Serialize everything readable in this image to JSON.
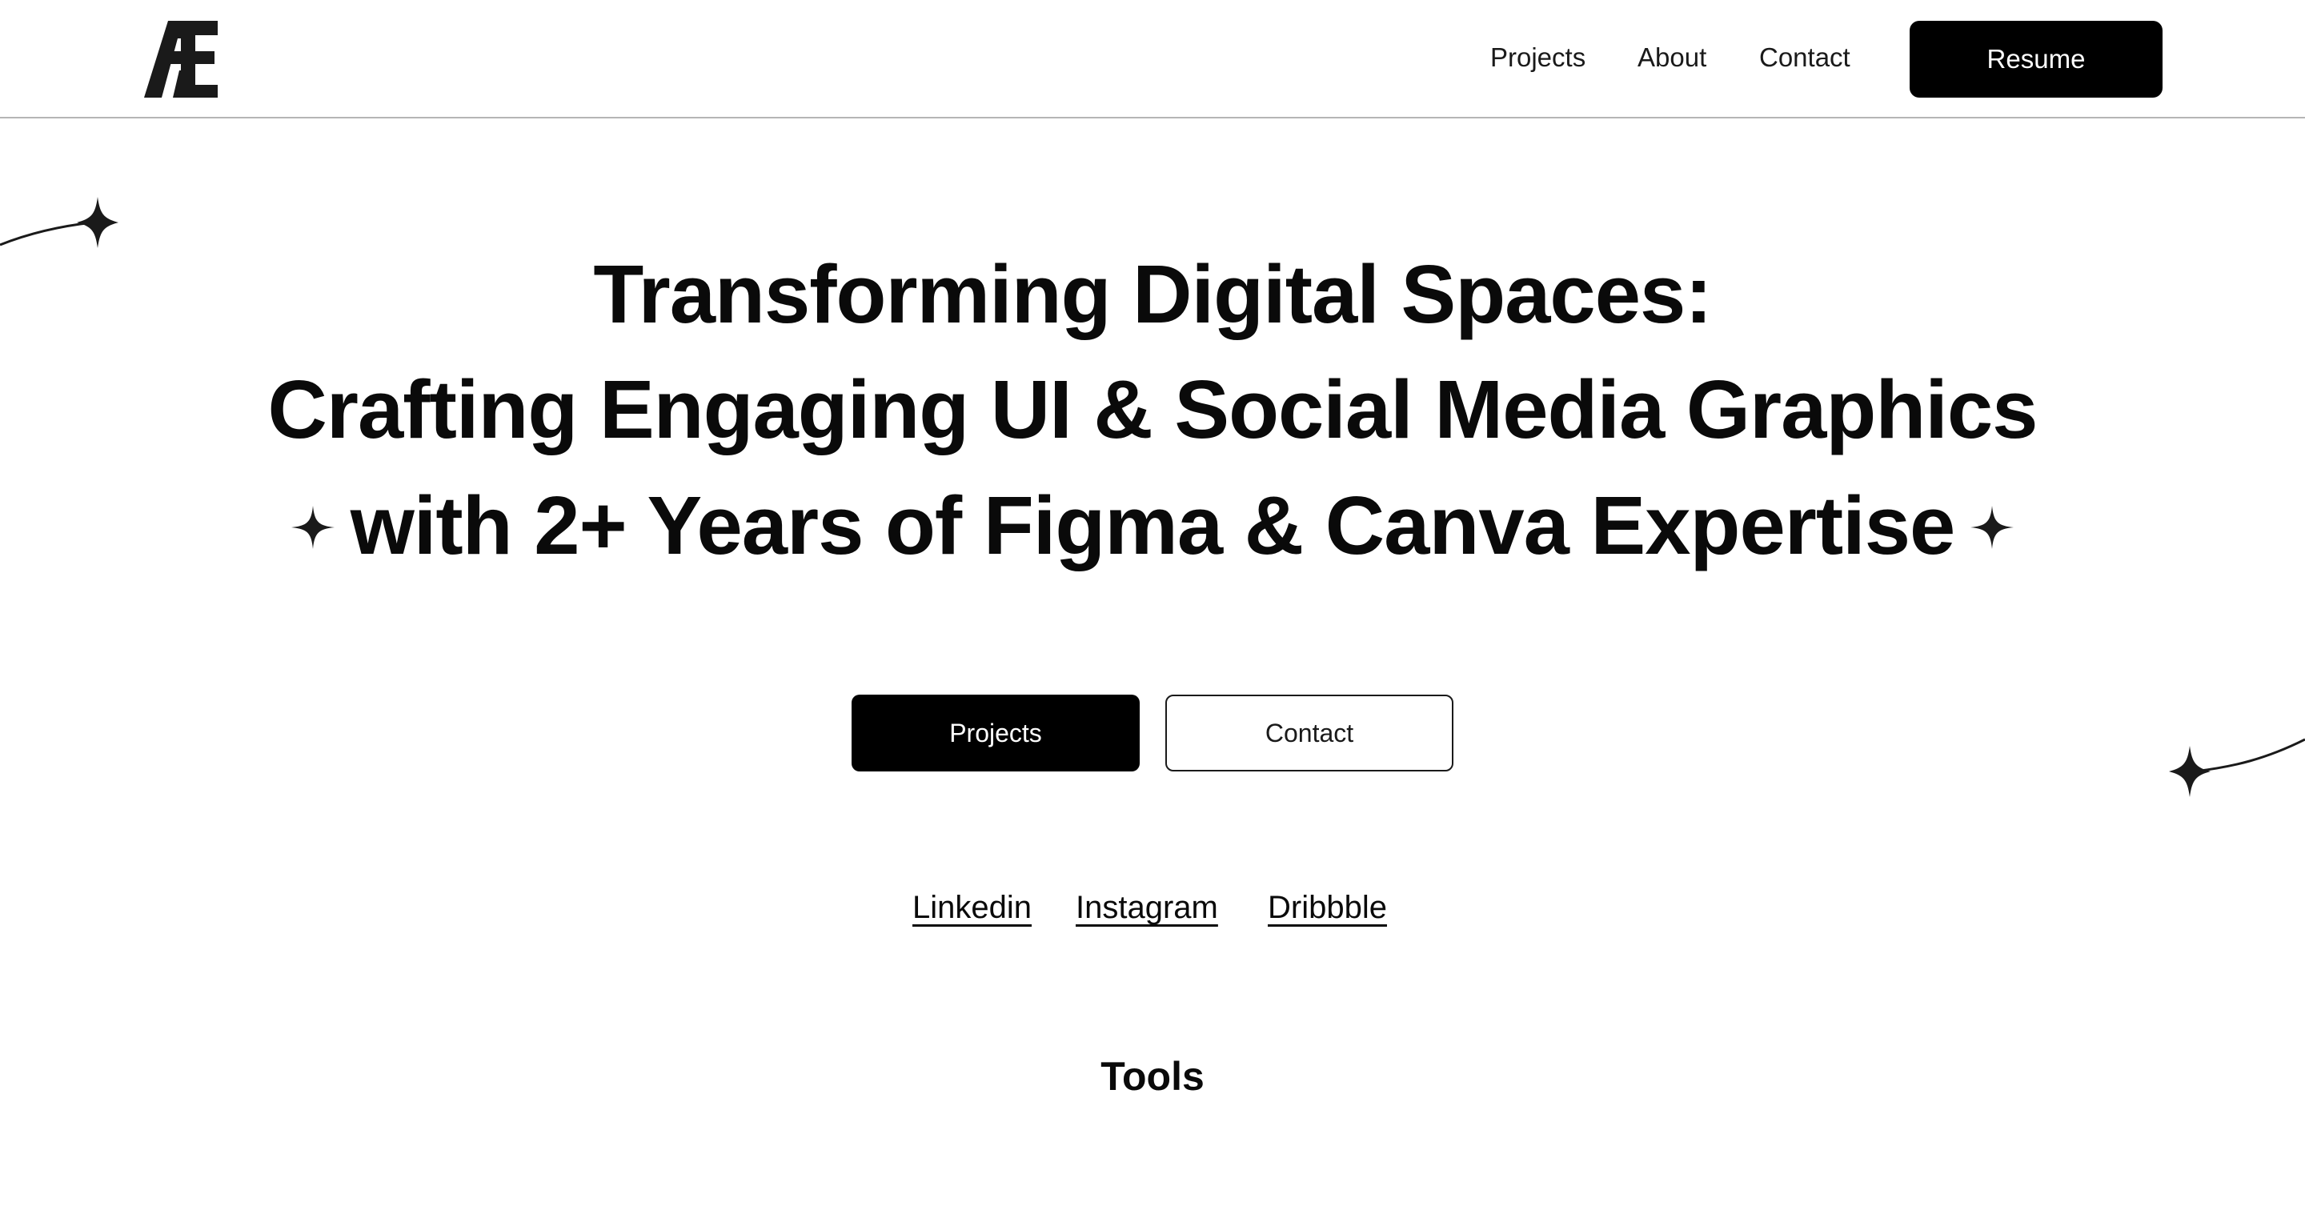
{
  "header": {
    "logo_text": "AE",
    "nav": [
      {
        "label": "Projects"
      },
      {
        "label": "About"
      },
      {
        "label": "Contact"
      }
    ],
    "resume_label": "Resume"
  },
  "hero": {
    "line1": "Transforming Digital Spaces:",
    "line2": "Crafting Engaging UI & Social Media Graphics",
    "line3": "with 2+ Years of Figma & Canva Expertise"
  },
  "cta": {
    "primary_label": "Projects",
    "secondary_label": "Contact"
  },
  "social": [
    {
      "label": "Linkedin"
    },
    {
      "label": "Instagram"
    },
    {
      "label": "Dribbble"
    }
  ],
  "tools": {
    "heading": "Tools"
  },
  "icons": {
    "logo": "ae-monogram-logo",
    "decor": "four-point-sparkle-icon"
  },
  "colors": {
    "background": "#ffffff",
    "text": "#0a0a0a",
    "button_dark": "#000000",
    "divider": "#b5b5b5"
  }
}
